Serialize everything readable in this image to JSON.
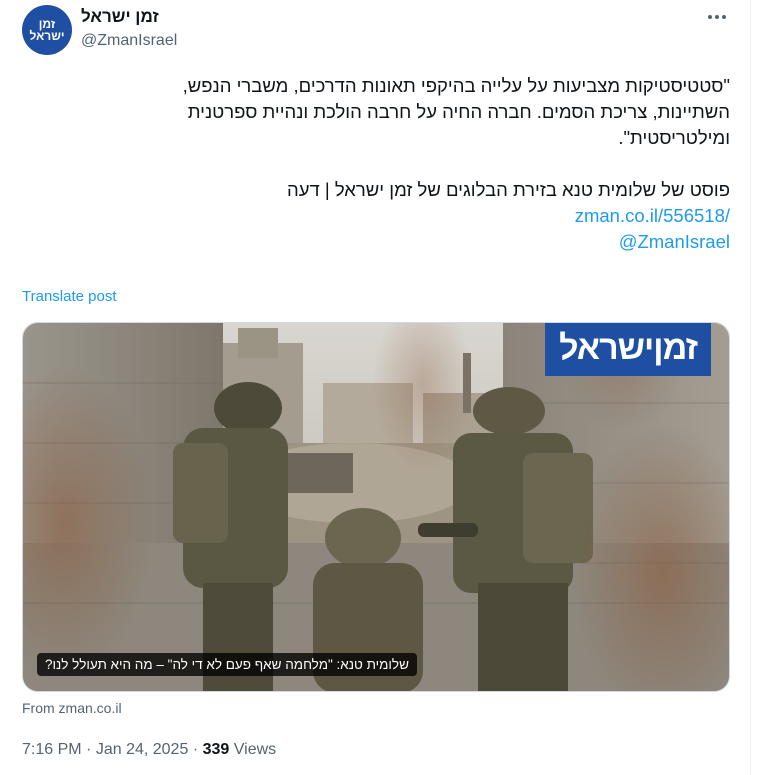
{
  "author": {
    "display_name": "זמן ישראל",
    "handle": "@ZmanIsrael",
    "avatar_line1": "זמן",
    "avatar_line2": "ישראל"
  },
  "tweet": {
    "text_line1": "\"סטטיסטיקות מצביעות על עלייה בהיקפי תאונות הדרכים, משברי הנפש,",
    "text_line2": "השתיינות, צריכת הסמים. חברה החיה על חרבה הולכת ונהיית ספרטנית",
    "text_line3": "ומילטריסטית\".",
    "text_line4": "פוסט של שלומית טנא בזירת הבלוגים של זמן ישראל | דעה",
    "link_url": "zman.co.il/556518/",
    "mention": "@ZmanIsrael",
    "translate_label": "Translate post"
  },
  "media": {
    "brand_badge": "זמןישראל",
    "caption": "שלומית טנא: \"מלחמה שאף פעם לא די לה\" – מה היא תעולל לנו?",
    "source": "From zman.co.il"
  },
  "meta": {
    "time": "7:16 PM",
    "separator": "·",
    "date": "Jan 24, 2025",
    "views_count": "339",
    "views_label": "Views"
  },
  "colors": {
    "brand_blue": "#1e4fa3",
    "link_blue": "#1d9bf0",
    "muted_gray": "#536471"
  },
  "icons": {
    "more": "more-horizontal-icon"
  }
}
